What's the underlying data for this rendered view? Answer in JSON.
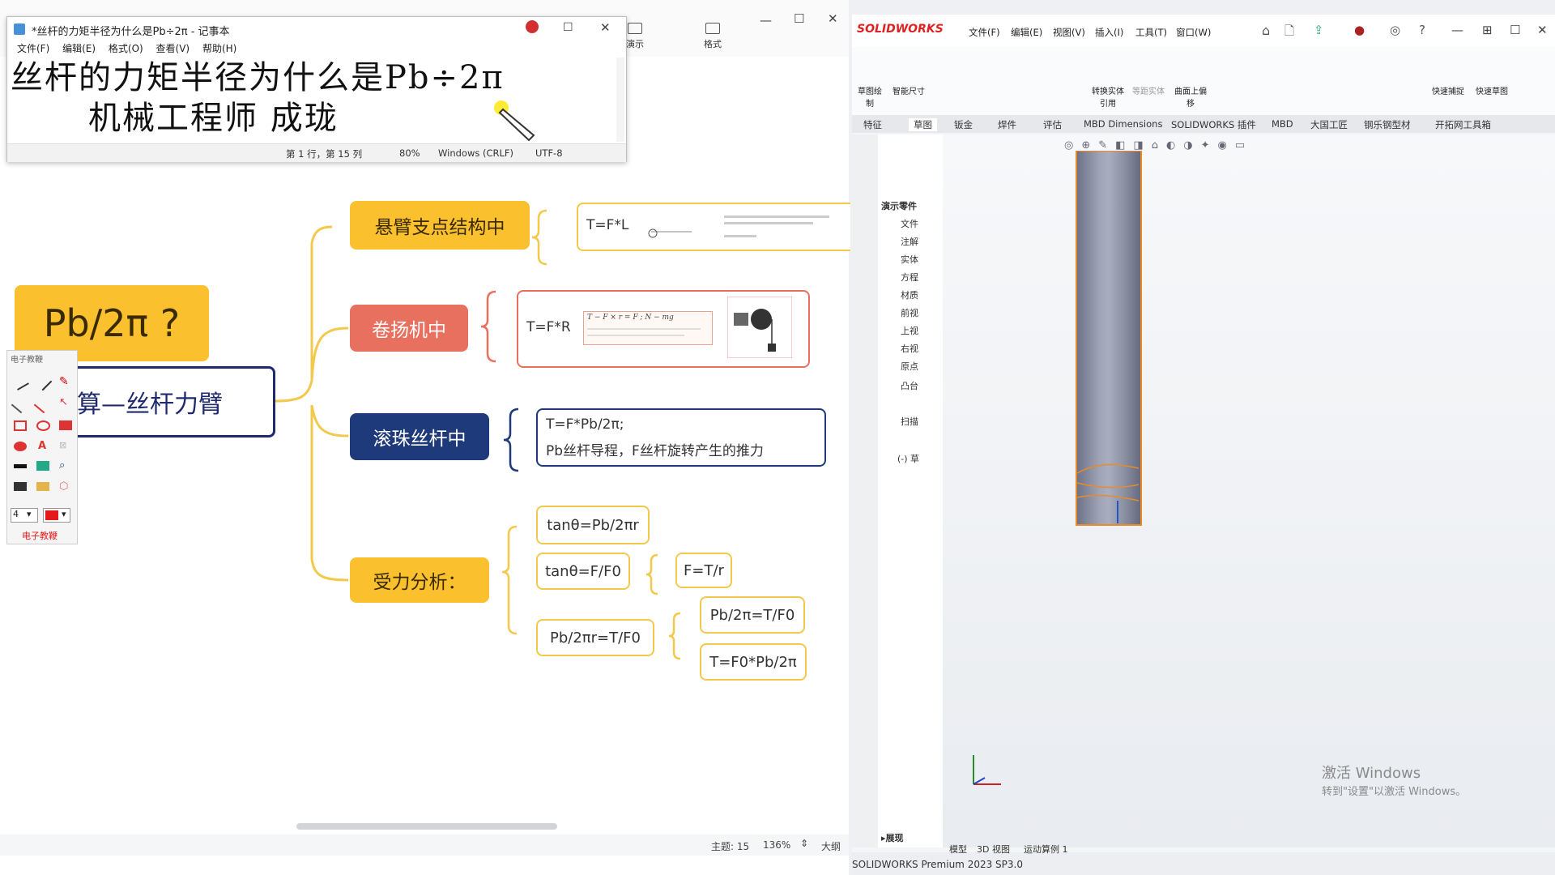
{
  "mindmap_toolbar": {
    "demo_label": "演示",
    "style_label": "格式"
  },
  "notepad": {
    "title": "*丝杆的力矩半径为什么是Pb÷2π - 记事本",
    "menu": [
      "文件(F)",
      "编辑(E)",
      "格式(O)",
      "查看(V)",
      "帮助(H)"
    ],
    "line1": "丝杆的力矩半径为什么是Pb÷2π",
    "line2": "机械工程师   成珑",
    "status": {
      "position": "第 1 行，第 15 列",
      "zoom": "80%",
      "eol": "Windows (CRLF)",
      "encoding": "UTF-8"
    }
  },
  "mindmap": {
    "center_question": "Pb/2π ?",
    "center_label": "算—丝杆力臂",
    "branches": [
      {
        "label": "悬臂支点结构中",
        "formula": "T=F*L",
        "color": "#fbc02d"
      },
      {
        "label": "卷扬机中",
        "formula": "T=F*R",
        "color": "#e8705e",
        "figure_text": "T − F × r = F ; N − mg"
      },
      {
        "label": "滚珠丝杆中",
        "formula1": "T=F*Pb/2π;",
        "formula2": "Pb丝杆导程，F丝杆旋转产生的推力",
        "color": "#1f3a7a"
      },
      {
        "label": "受力分析：",
        "color": "#fbc02d"
      }
    ],
    "force": {
      "f1": "tanθ=Pb/2πr",
      "f2": "tanθ=F/F0",
      "f3": "F=T/r",
      "f4": "Pb/2πr=T/F0",
      "f5": "Pb/2π=T/F0",
      "f6": "T=F0*Pb/2π"
    },
    "status": {
      "theme": "主题: 15",
      "zoom": "136%",
      "size": "大纲"
    }
  },
  "pen_toolbar": {
    "title": "电子教鞭",
    "footer": "电子教鞭",
    "size": "4"
  },
  "solidworks": {
    "brand": "SOLIDWORKS",
    "menu": [
      "文件(F)",
      "编辑(E)",
      "视图(V)",
      "插入(I)",
      "工具(T)",
      "窗口(W)"
    ],
    "ribbon": [
      "草图绘制",
      "智能尺寸",
      "转换实体引用",
      "等距实体",
      "曲面上偏移",
      "快速捕捉",
      "快速草图"
    ],
    "tabs": [
      "特征",
      "草图",
      "钣金",
      "焊件",
      "评估",
      "MBD Dimensions",
      "SOLIDWORKS 插件",
      "MBD",
      "大国工匠",
      "钢乐钢型材",
      "开拓网工具箱"
    ],
    "tree": [
      "演示零件",
      "文件",
      "注解",
      "实体",
      "方程",
      "材质",
      "前视",
      "上视",
      "右视",
      "原点",
      "凸台",
      "扫描",
      "(-) 草"
    ],
    "bottom_tabs": [
      "模型",
      "3D 视图",
      "运动算例 1"
    ],
    "status": "SOLIDWORKS Premium 2023 SP3.0",
    "collapse_label": "▸展现"
  },
  "windows": {
    "activate_line1": "激活 Windows",
    "activate_line2": "转到\"设置\"以激活 Windows。"
  }
}
